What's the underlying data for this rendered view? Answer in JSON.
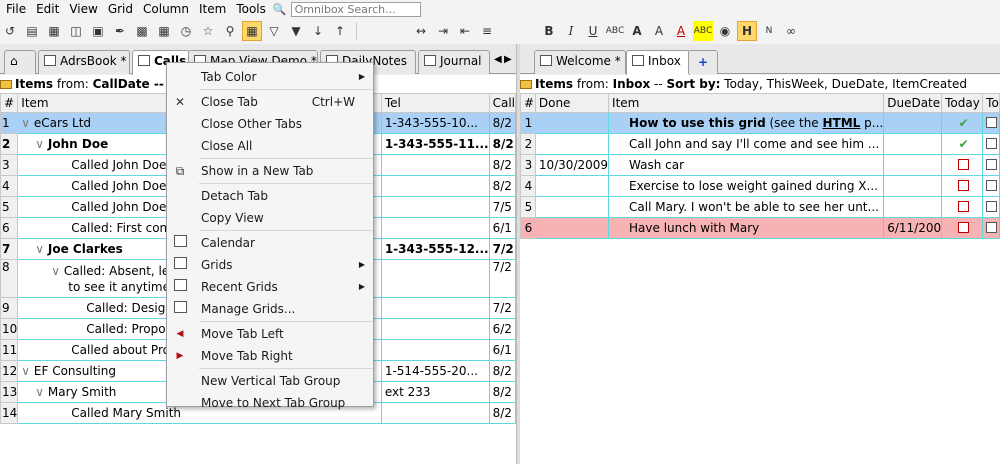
{
  "menubar": {
    "items": [
      "File",
      "Edit",
      "View",
      "Grid",
      "Column",
      "Item",
      "Tools"
    ],
    "omnibox_placeholder": "Omnibox Search..."
  },
  "tabs_left": [
    {
      "label": "",
      "icon": "home-icon"
    },
    {
      "label": "AdrsBook *"
    },
    {
      "label": "Calls"
    },
    {
      "label": "Map View Demo *"
    },
    {
      "label": "DailyNotes"
    },
    {
      "label": "Journal"
    }
  ],
  "tabs_right": [
    {
      "label": "Welcome *"
    },
    {
      "label": "Inbox"
    },
    {
      "label": "+"
    }
  ],
  "left_pane": {
    "info_prefix": "Items",
    "info_from": "from:",
    "info_source": "CallDate -- So",
    "columns": [
      "#",
      "Item",
      "Tel",
      "Call"
    ],
    "rows": [
      {
        "num": "1",
        "item": "eCars Ltd",
        "tel": "1-343-555-10...",
        "call": "8/2"
      },
      {
        "num": "2",
        "item": "John Doe",
        "tel": "1-343-555-11...",
        "call": "8/2"
      },
      {
        "num": "3",
        "item": "Called John Doe: M",
        "tel": "",
        "call": "8/2"
      },
      {
        "num": "4",
        "item": "Called John Doe: N",
        "tel": "",
        "call": "8/2"
      },
      {
        "num": "5",
        "item": "Called John Doe: S",
        "tel": "",
        "call": "7/5"
      },
      {
        "num": "6",
        "item": "Called: First conta",
        "tel": "",
        "call": "6/1"
      },
      {
        "num": "7",
        "item": "Joe Clarkes",
        "tel": "1-343-555-12...",
        "call": "7/2"
      },
      {
        "num": "8",
        "item": "Called: Absent, lef",
        "item2": "to see it anytime",
        "tel": "",
        "call": "7/2"
      },
      {
        "num": "9",
        "item": "Called: Design d",
        "tel": "",
        "call": "7/2"
      },
      {
        "num": "10",
        "item": "Called: Propose",
        "tel": "",
        "call": "6/2"
      },
      {
        "num": "11",
        "item": "Called about Proje",
        "tel": "",
        "call": "6/1"
      },
      {
        "num": "12",
        "item": "EF Consulting",
        "tel": "1-514-555-20...",
        "call": "8/2"
      },
      {
        "num": "13",
        "item": "Mary Smith",
        "tel": "ext 233",
        "call": "8/2"
      },
      {
        "num": "14",
        "item": "Called Mary Smith",
        "tel": "",
        "call": "8/2"
      }
    ]
  },
  "right_pane": {
    "info_prefix": "Items",
    "info_from": "from:",
    "info_source": "Inbox",
    "info_sort_label": "Sort by:",
    "info_sort": "Today, ThisWeek, DueDate, ItemCreated",
    "columns": [
      "#",
      "Done",
      "Item",
      "DueDate",
      "Today",
      "To"
    ],
    "rows": [
      {
        "num": "1",
        "done": "",
        "item_bold": "How to use this grid",
        "item_rest": " (see the ",
        "item_html": "HTML",
        "item_tail": " p...",
        "due": "",
        "today": "check"
      },
      {
        "num": "2",
        "done": "",
        "item": "Call John and say I'll come and see him ...",
        "due": "",
        "today": "check"
      },
      {
        "num": "3",
        "done": "10/30/2009",
        "item": "Wash car",
        "due": "",
        "today": "box"
      },
      {
        "num": "4",
        "done": "",
        "item": "Exercise to lose weight gained during X...",
        "due": "",
        "today": "box"
      },
      {
        "num": "5",
        "done": "",
        "item": "Call Mary. I won't be able to see her unt...",
        "due": "",
        "today": "box"
      },
      {
        "num": "6",
        "done": "",
        "item": "Have lunch with Mary",
        "due": "6/11/200",
        "today": "box"
      }
    ]
  },
  "context_menu": {
    "items": [
      {
        "label": "Tab Color",
        "submenu": true
      },
      {
        "label": "Close Tab",
        "shortcut": "Ctrl+W",
        "icon": "close-icon"
      },
      {
        "label": "Close Other Tabs"
      },
      {
        "label": "Close All"
      },
      {
        "label": "Show in a New Tab",
        "icon": "new-tab-icon"
      },
      {
        "label": "Detach Tab"
      },
      {
        "label": "Copy View"
      },
      {
        "label": "Calendar",
        "icon": "calendar-icon"
      },
      {
        "label": "Grids",
        "submenu": true,
        "icon": "grids-icon"
      },
      {
        "label": "Recent Grids",
        "submenu": true,
        "icon": "recent-grids-icon"
      },
      {
        "label": "Manage Grids...",
        "icon": "manage-grids-icon"
      },
      {
        "label": "Move Tab Left",
        "icon": "arrow-left-icon"
      },
      {
        "label": "Move Tab Right",
        "icon": "arrow-right-icon"
      },
      {
        "label": "New Vertical Tab Group"
      },
      {
        "label": "Move to Next Tab Group"
      }
    ]
  },
  "colors": {
    "selected_row": "#aad0f5",
    "pink_row": "#f7b3b3",
    "grid_line": "#5fd9e0",
    "highlight_button": "#ffd76a"
  }
}
